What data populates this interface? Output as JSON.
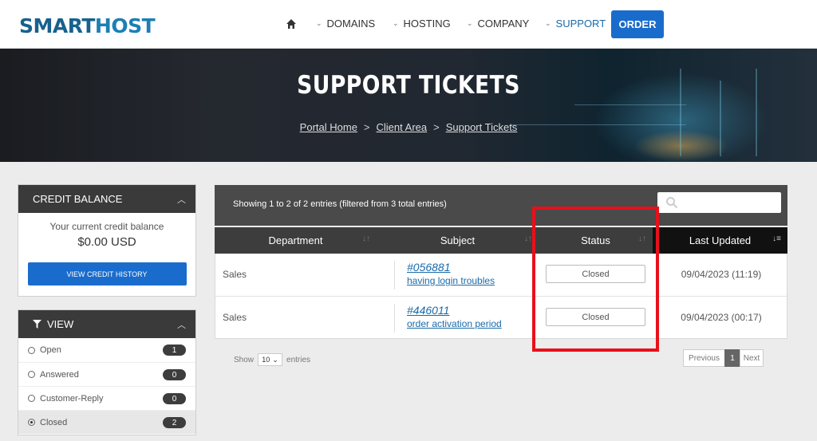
{
  "brand": {
    "logo_main": "SMART",
    "logo_accent": "HOST"
  },
  "nav": {
    "items": [
      {
        "label": "DOMAINS"
      },
      {
        "label": "HOSTING"
      },
      {
        "label": "COMPANY"
      },
      {
        "label": "SUPPORT"
      }
    ],
    "order_label": "ORDER"
  },
  "hero": {
    "title": "SUPPORT TICKETS",
    "breadcrumb": [
      "Portal Home",
      "Client Area",
      "Support Tickets"
    ]
  },
  "credit": {
    "title": "CREDIT BALANCE",
    "label": "Your current credit balance",
    "amount": "$0.00 USD",
    "button": "VIEW CREDIT HISTORY"
  },
  "view": {
    "title": "VIEW",
    "filters": [
      {
        "label": "Open",
        "count": "1"
      },
      {
        "label": "Answered",
        "count": "0"
      },
      {
        "label": "Customer-Reply",
        "count": "0"
      },
      {
        "label": "Closed",
        "count": "2"
      }
    ],
    "selected": "Closed"
  },
  "table": {
    "info": "Showing 1 to 2 of 2 entries (filtered from 3 total entries)",
    "search_placeholder": "",
    "columns": [
      "Department",
      "Subject",
      "Status",
      "Last Updated"
    ],
    "rows": [
      {
        "department": "Sales",
        "ticket_id": "#056881",
        "subject": "having login troubles",
        "status": "Closed",
        "last_updated": "09/04/2023 (11:19)"
      },
      {
        "department": "Sales",
        "ticket_id": "#446011",
        "subject": "order activation period",
        "status": "Closed",
        "last_updated": "09/04/2023 (00:17)"
      }
    ]
  },
  "footer": {
    "show_label": "Show",
    "page_length": "10",
    "entries_label": "entries",
    "pagination": {
      "previous": "Previous",
      "current": "1",
      "next": "Next"
    }
  },
  "colors": {
    "accent": "#1a6ccc",
    "highlight": "#e8101a",
    "header_dark": "#3d3d3d"
  }
}
